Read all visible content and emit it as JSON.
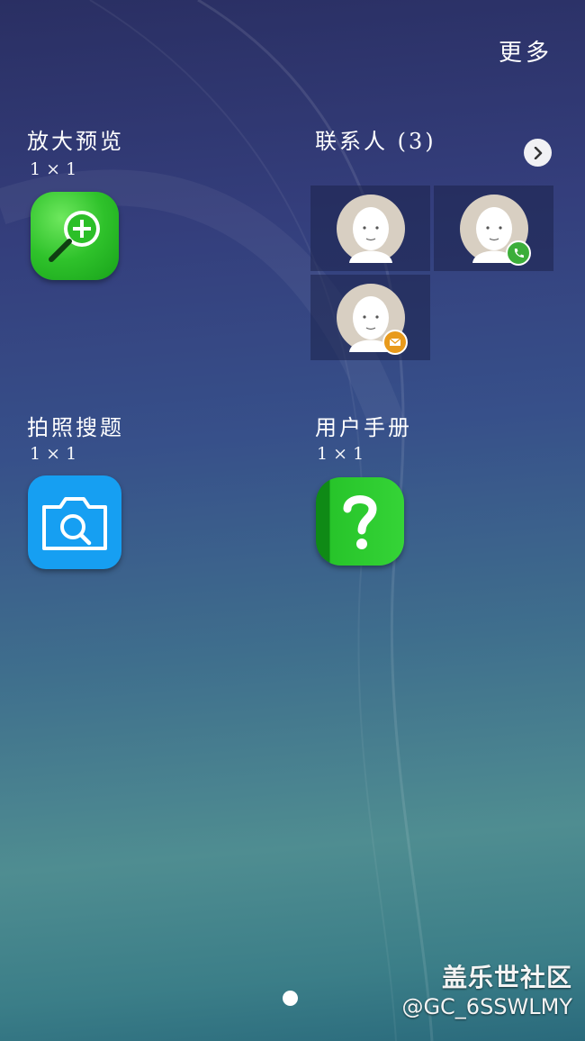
{
  "header": {
    "more_label": "更多"
  },
  "widgets": [
    {
      "title": "放大预览",
      "size": "1 × 1",
      "icon": "zoom-in-icon"
    },
    {
      "title": "联系人 (3)",
      "icon": "chevron-right-icon"
    },
    {
      "title": "拍照搜题",
      "size": "1 × 1",
      "icon": "camera-search-icon"
    },
    {
      "title": "用户手册",
      "size": "1 × 1",
      "icon": "help-icon"
    }
  ],
  "contacts": [
    {
      "icon": "avatar-icon",
      "badge": ""
    },
    {
      "icon": "avatar-icon",
      "badge": "phone-icon"
    },
    {
      "icon": "avatar-icon",
      "badge": "mail-icon"
    }
  ],
  "watermark": {
    "line1": "盖乐世社区",
    "line2": "@GC_6SSWLMY"
  },
  "colors": {
    "zoom_green": "#2fc22b",
    "camera_blue": "#169ff2",
    "help_green": "#27c42a",
    "phone_badge": "#3cae3a",
    "mail_badge": "#e89a1c"
  }
}
